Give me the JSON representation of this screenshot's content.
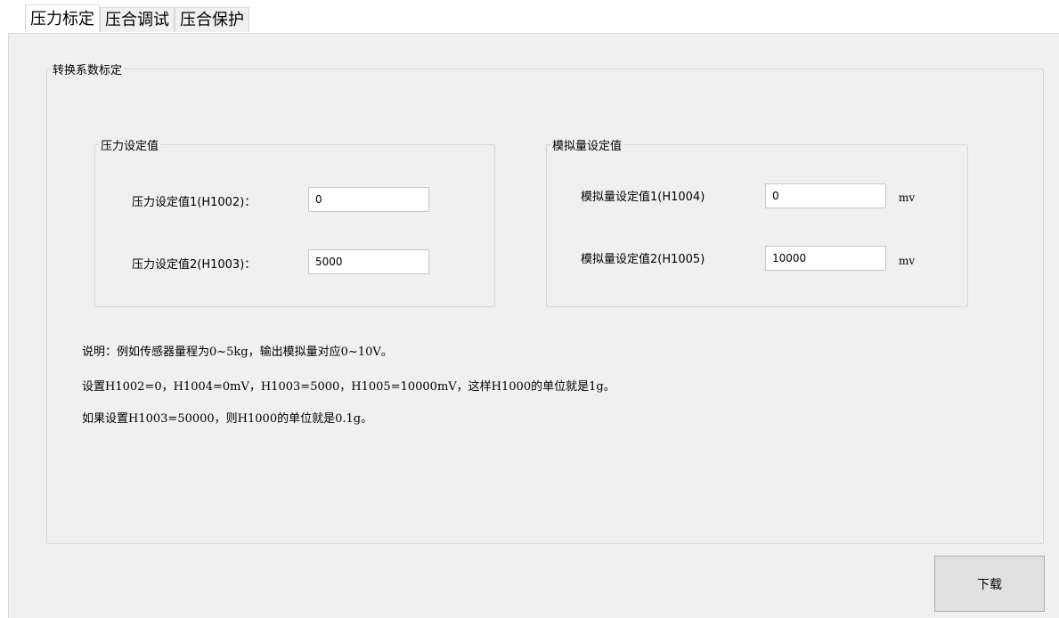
{
  "tabs": [
    {
      "label": "压力标定",
      "active": true
    },
    {
      "label": "压合调试",
      "active": false
    },
    {
      "label": "压合保护",
      "active": false
    }
  ],
  "outer_group": {
    "title": "转换系数标定"
  },
  "pressure_group": {
    "title": "压力设定值",
    "fields": [
      {
        "label": "压力设定值1(H1002)：",
        "value": "0"
      },
      {
        "label": "压力设定值2(H1003)：",
        "value": "5000"
      }
    ]
  },
  "analog_group": {
    "title": "模拟量设定值",
    "fields": [
      {
        "label": "模拟量设定值1(H1004)",
        "value": "0",
        "unit": "mv"
      },
      {
        "label": "模拟量设定值2(H1005)",
        "value": "10000",
        "unit": "mv"
      }
    ]
  },
  "notes": [
    "说明：例如传感器量程为0~5kg，输出模拟量对应0~10V。",
    "设置H1002=0，H1004=0mV，H1003=5000，H1005=10000mV，这样H1000的单位就是1g。",
    "如果设置H1003=50000，则H1000的单位就是0.1g。"
  ],
  "download_button": {
    "label": "下载"
  }
}
